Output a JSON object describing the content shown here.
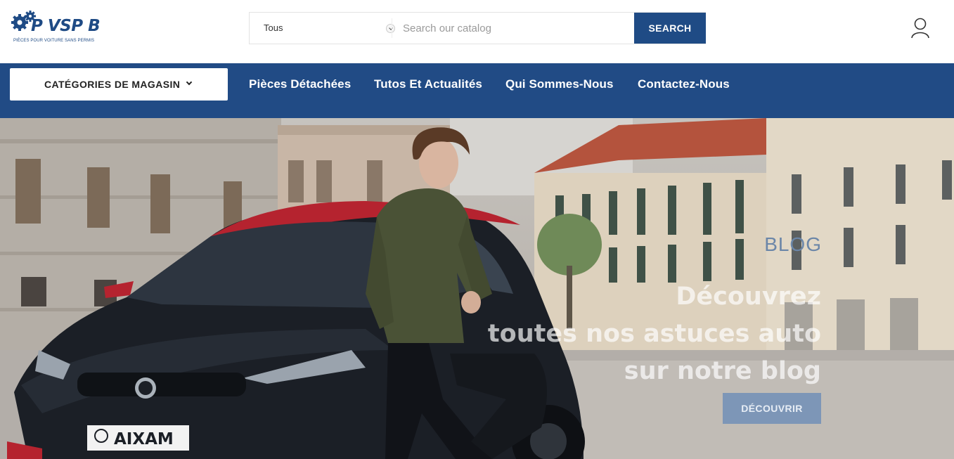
{
  "logo": {
    "name": "P VSP B",
    "tagline": "PIÈCES POUR VOITURE SANS PERMIS"
  },
  "search": {
    "category_value": "Tous",
    "placeholder": "Search our catalog",
    "query": "",
    "button_label": "SEARCH"
  },
  "account": {
    "icon": "user-icon"
  },
  "nav": {
    "categories_label": "CATÉGORIES DE MAGASIN",
    "links": [
      {
        "label": "Pièces Détachées"
      },
      {
        "label": "Tutos Et Actualités"
      },
      {
        "label": "Qui Sommes-Nous"
      },
      {
        "label": "Contactez-Nous"
      }
    ]
  },
  "hero": {
    "tag": "BLOG",
    "title_lines": [
      "Découvrez",
      "toutes nos astuces auto",
      "sur notre blog"
    ],
    "button_label": "DÉCOUVRIR",
    "plate_text": "AIXAM"
  },
  "colors": {
    "brand_blue": "#214b85",
    "search_button": "#1f4b85",
    "cta_button": "#7d96b7"
  }
}
